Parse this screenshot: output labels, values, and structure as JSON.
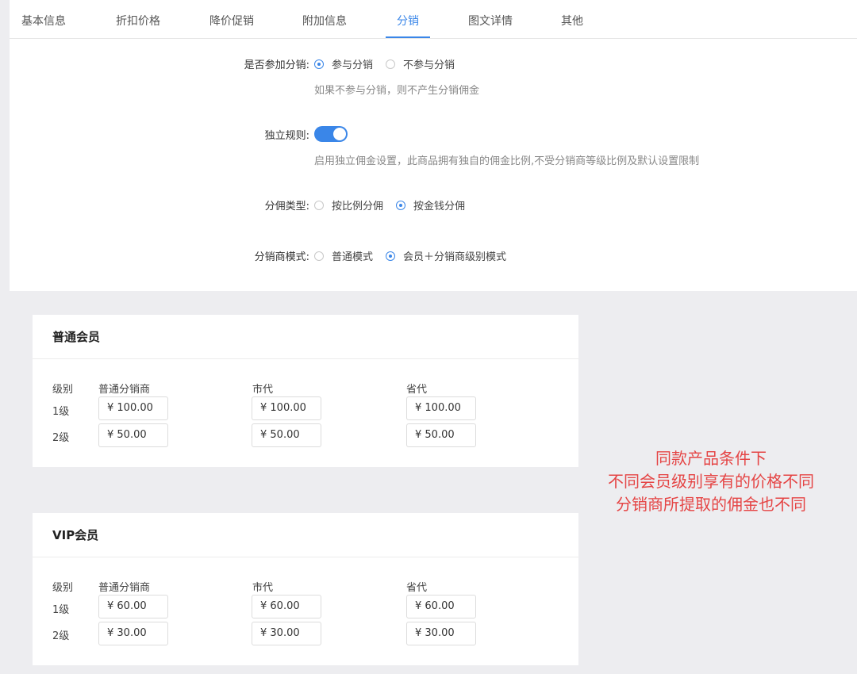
{
  "tabs": [
    "基本信息",
    "折扣价格",
    "降价促销",
    "附加信息",
    "分销",
    "图文详情",
    "其他"
  ],
  "form": {
    "participate": {
      "label": "是否参加分销:",
      "options": [
        "参与分销",
        "不参与分销"
      ],
      "selected": "参与分销",
      "hint": "如果不参与分销，则不产生分销佣金"
    },
    "independent": {
      "label": "独立规则:",
      "enabled": true,
      "hint": "启用独立佣金设置，此商品拥有独自的佣金比例,不受分销商等级比例及默认设置限制"
    },
    "commission_type": {
      "label": "分佣类型:",
      "options": [
        "按比例分佣",
        "按金钱分佣"
      ],
      "selected": "按金钱分佣"
    },
    "mode": {
      "label": "分销商模式:",
      "options": [
        "普通模式",
        "会员＋分销商级别模式"
      ],
      "selected": "会员＋分销商级别模式"
    }
  },
  "cards": [
    {
      "title": "普通会员",
      "headers": [
        "级别",
        "普通分销商",
        "市代",
        "省代"
      ],
      "rows": [
        {
          "level": "1级",
          "values": [
            "¥ 100.00",
            "¥ 100.00",
            "¥ 100.00"
          ]
        },
        {
          "level": "2级",
          "values": [
            "¥ 50.00",
            "¥ 50.00",
            "¥ 50.00"
          ]
        }
      ]
    },
    {
      "title": "VIP会员",
      "headers": [
        "级别",
        "普通分销商",
        "市代",
        "省代"
      ],
      "rows": [
        {
          "level": "1级",
          "values": [
            "¥ 60.00",
            "¥ 60.00",
            "¥ 60.00"
          ]
        },
        {
          "level": "2级",
          "values": [
            "¥ 30.00",
            "¥ 30.00",
            "¥ 30.00"
          ]
        }
      ]
    }
  ],
  "annotation": [
    "同款产品条件下",
    "不同会员级别享有的价格不同",
    "分销商所提取的佣金也不同"
  ],
  "colors": {
    "accent": "#3a86e8",
    "annotation": "#e54545"
  }
}
